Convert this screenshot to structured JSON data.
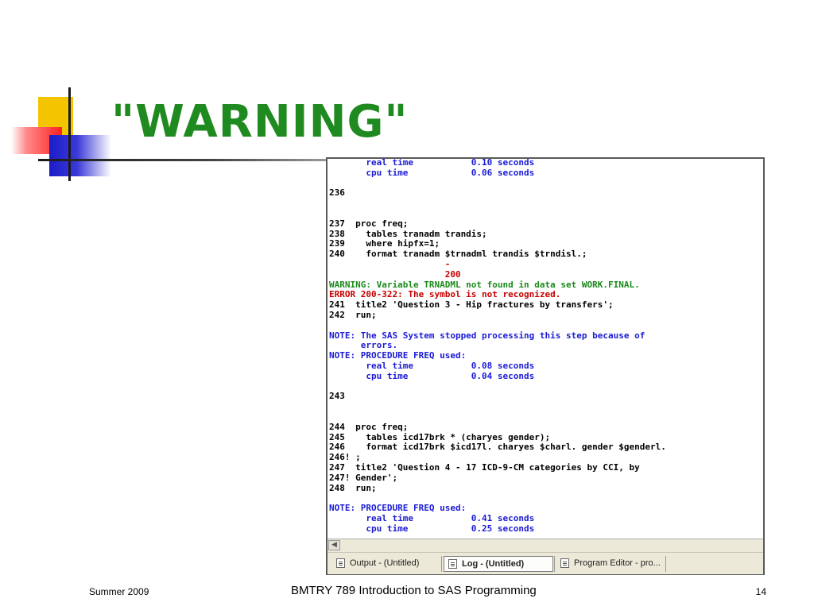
{
  "slide": {
    "title": "\"WARNING\"",
    "footer_left": "Summer 2009",
    "footer_center": "BMTRY 789 Introduction to SAS Programming",
    "page_number": "14"
  },
  "log": {
    "lines": [
      {
        "text": "       real time           0.10 seconds",
        "color": "blue"
      },
      {
        "text": "       cpu time            0.06 seconds",
        "color": "blue"
      },
      {
        "text": "",
        "color": "black"
      },
      {
        "text": "236",
        "color": "black"
      },
      {
        "text": "",
        "color": "black"
      },
      {
        "text": "",
        "color": "black"
      },
      {
        "text": "237  proc freq;",
        "color": "black"
      },
      {
        "text": "238    tables tranadm trandis;",
        "color": "black"
      },
      {
        "text": "239    where hipfx=1;",
        "color": "black"
      },
      {
        "text": "240    format tranadm $trnadml trandis $trndisl.;",
        "color": "black"
      },
      {
        "text": "                      -",
        "color": "red"
      },
      {
        "text": "                      200",
        "color": "red"
      },
      {
        "text": "WARNING: Variable TRNADML not found in data set WORK.FINAL.",
        "color": "green"
      },
      {
        "text": "ERROR 200-322: The symbol is not recognized.",
        "color": "red"
      },
      {
        "text": "241  title2 'Question 3 - Hip fractures by transfers';",
        "color": "black"
      },
      {
        "text": "242  run;",
        "color": "black"
      },
      {
        "text": "",
        "color": "black"
      },
      {
        "text": "NOTE: The SAS System stopped processing this step because of",
        "color": "blue"
      },
      {
        "text": "      errors.",
        "color": "blue"
      },
      {
        "text": "NOTE: PROCEDURE FREQ used:",
        "color": "blue"
      },
      {
        "text": "       real time           0.08 seconds",
        "color": "blue"
      },
      {
        "text": "       cpu time            0.04 seconds",
        "color": "blue"
      },
      {
        "text": "",
        "color": "black"
      },
      {
        "text": "243",
        "color": "black"
      },
      {
        "text": "",
        "color": "black"
      },
      {
        "text": "",
        "color": "black"
      },
      {
        "text": "244  proc freq;",
        "color": "black"
      },
      {
        "text": "245    tables icd17brk * (charyes gender);",
        "color": "black"
      },
      {
        "text": "246    format icd17brk $icd17l. charyes $charl. gender $genderl.",
        "color": "black"
      },
      {
        "text": "246! ;",
        "color": "black"
      },
      {
        "text": "247  title2 'Question 4 - 17 ICD-9-CM categories by CCI, by",
        "color": "black"
      },
      {
        "text": "247! Gender';",
        "color": "black"
      },
      {
        "text": "248  run;",
        "color": "black"
      },
      {
        "text": "",
        "color": "black"
      },
      {
        "text": "NOTE: PROCEDURE FREQ used:",
        "color": "blue"
      },
      {
        "text": "       real time           0.41 seconds",
        "color": "blue"
      },
      {
        "text": "       cpu time            0.25 seconds",
        "color": "blue"
      }
    ]
  },
  "window": {
    "scroll_left_icon": "chevron-left-icon",
    "tabs": [
      {
        "label": "Output - (Untitled)",
        "icon": "output-window-icon",
        "active": false
      },
      {
        "label": "Log - (Untitled)",
        "icon": "log-window-icon",
        "active": true
      },
      {
        "label": "Program Editor - pro...",
        "icon": "program-editor-icon",
        "active": false
      }
    ]
  },
  "colors": {
    "title": "#1f8a1f",
    "log_blue": "#1b1bd6",
    "log_green": "#1a8a1a",
    "log_red": "#c80000",
    "log_black": "#000000"
  }
}
